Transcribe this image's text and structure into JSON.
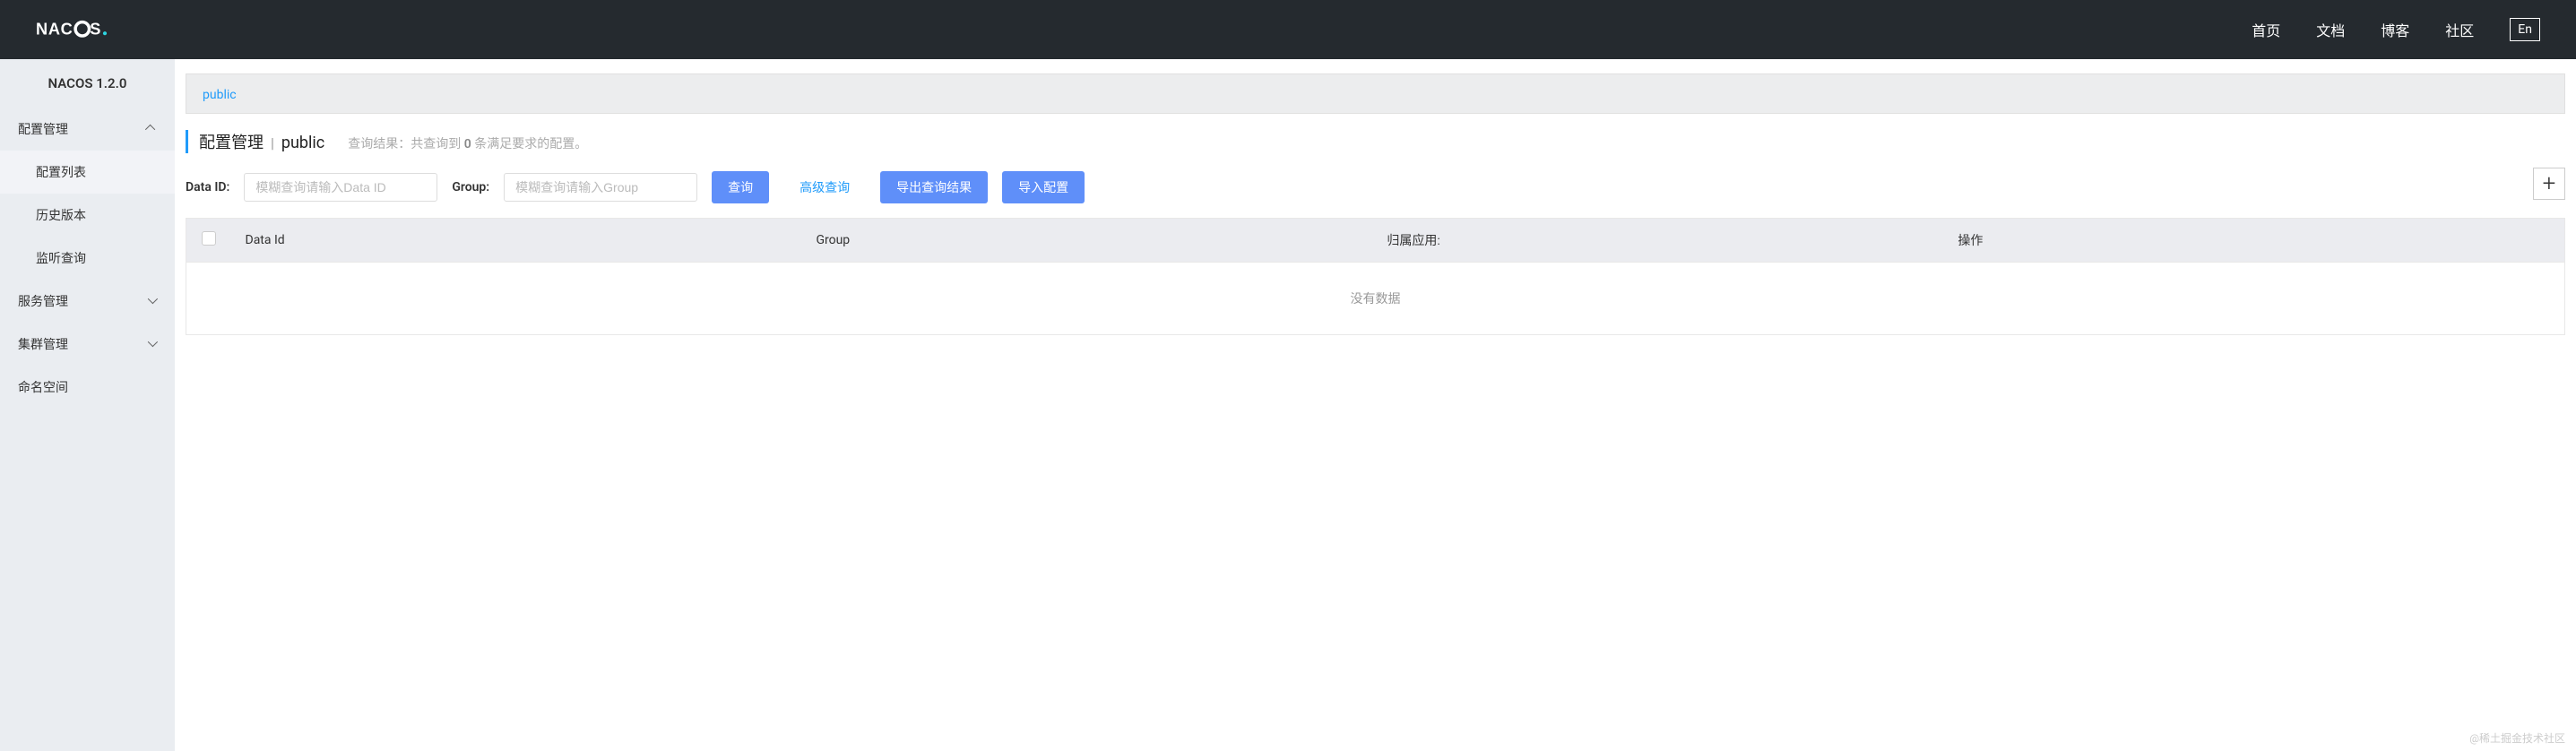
{
  "header": {
    "nav": [
      "首页",
      "文档",
      "博客",
      "社区"
    ],
    "lang": "En"
  },
  "sidebar": {
    "title": "NACOS 1.2.0",
    "sections": [
      {
        "label": "配置管理",
        "expanded": true,
        "items": [
          "配置列表",
          "历史版本",
          "监听查询"
        ]
      },
      {
        "label": "服务管理",
        "expanded": false
      },
      {
        "label": "集群管理",
        "expanded": false
      },
      {
        "label": "命名空间",
        "expanded": null
      }
    ]
  },
  "namespace": {
    "active": "public"
  },
  "page": {
    "title": "配置管理",
    "sep": "|",
    "scope": "public",
    "result_prefix": "查询结果：共查询到 ",
    "result_count": "0",
    "result_suffix": " 条满足要求的配置。"
  },
  "search": {
    "data_id_label": "Data ID:",
    "data_id_placeholder": "模糊查询请输入Data ID",
    "group_label": "Group:",
    "group_placeholder": "模糊查询请输入Group",
    "query_btn": "查询",
    "advanced_btn": "高级查询",
    "export_btn": "导出查询结果",
    "import_btn": "导入配置"
  },
  "table": {
    "columns": [
      "Data Id",
      "Group",
      "归属应用:",
      "操作"
    ],
    "empty": "没有数据"
  },
  "watermark": "@稀土掘金技术社区"
}
